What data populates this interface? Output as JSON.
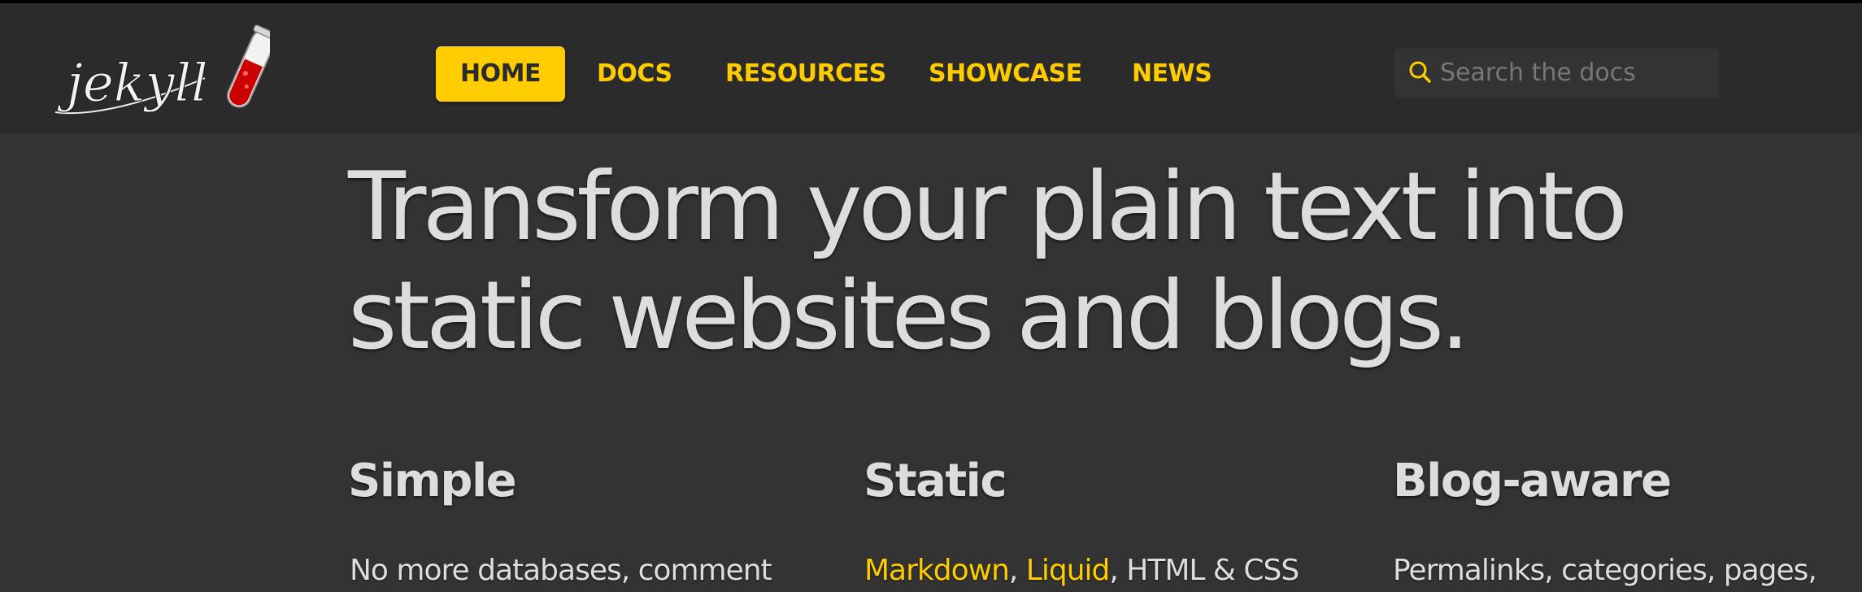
{
  "header": {
    "logo_text": "jekyll",
    "nav": [
      {
        "label": "HOME",
        "active": true
      },
      {
        "label": "DOCS",
        "active": false
      },
      {
        "label": "RESOURCES",
        "active": false
      },
      {
        "label": "SHOWCASE",
        "active": false
      },
      {
        "label": "NEWS",
        "active": false
      }
    ],
    "search": {
      "placeholder": "Search the docs",
      "value": ""
    }
  },
  "hero": {
    "title_line1": "Transform your plain text into",
    "title_line2": "static websites and blogs."
  },
  "features": [
    {
      "title": "Simple",
      "text": "No more databases, comment"
    },
    {
      "title": "Static",
      "link1": "Markdown",
      "sep1": ", ",
      "link2": "Liquid",
      "rest": ", HTML & CSS"
    },
    {
      "title": "Blog-aware",
      "text": "Permalinks, categories, pages,"
    }
  ],
  "colors": {
    "accent": "#ffcc00",
    "header_bg": "#2b2b2b",
    "page_bg": "#333333",
    "text": "#dddddd"
  }
}
